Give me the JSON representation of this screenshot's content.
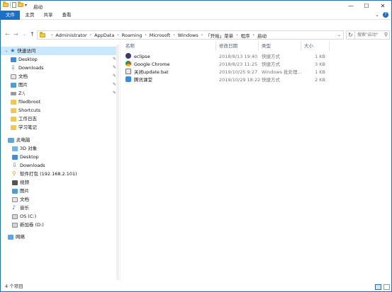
{
  "window": {
    "title": "启动"
  },
  "ribbon": {
    "tabs": [
      "文件",
      "主页",
      "共享",
      "查看"
    ]
  },
  "address": {
    "crumbs": [
      "Administrator",
      "AppData",
      "Roaming",
      "Microsoft",
      "Windows",
      "「开始」菜单",
      "程序",
      "启动"
    ]
  },
  "search": {
    "placeholder": "搜索\"启动\""
  },
  "nav": {
    "quick_access": "快速访问",
    "quick_items": [
      "Desktop",
      "Downloads",
      "文档",
      "图片",
      "Z:\\",
      "filedbroot",
      "Shortcuts",
      "工作日志",
      "学习笔记"
    ],
    "this_pc": "此电脑",
    "pc_items": [
      "3D 对象",
      "Desktop",
      "Downloads",
      "软件打包 (192.168.2.101)",
      "视频",
      "图片",
      "文档",
      "音乐",
      "OS (C:)",
      "新加卷 (D:)"
    ],
    "network": "网络"
  },
  "columns": {
    "name": "名称",
    "date": "修改日期",
    "type": "类型",
    "size": "大小"
  },
  "files": [
    {
      "name": "eclipse",
      "date": "2018/8/13 19:40",
      "type": "快捷方式",
      "size": "1 KB",
      "icon": "eclipse-icon"
    },
    {
      "name": "Google Chrome",
      "date": "2018/8/23 11:25",
      "type": "快捷方式",
      "size": "3 KB",
      "icon": "chrome-icon"
    },
    {
      "name": "关闭update.bat",
      "date": "2019/10/25 9:27",
      "type": "Windows 批处理...",
      "size": "1 KB",
      "icon": "bat-file-icon"
    },
    {
      "name": "腾讯课堂",
      "date": "2019/10/29 18:22",
      "type": "快捷方式",
      "size": "2 KB",
      "icon": "tencent-classroom-icon"
    }
  ],
  "status": {
    "count": "4 个项目"
  }
}
